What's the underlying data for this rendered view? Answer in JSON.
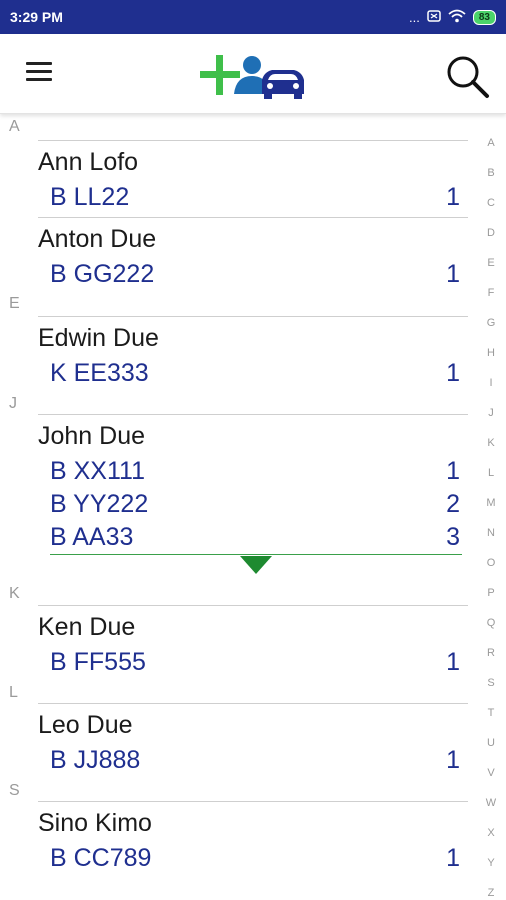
{
  "status_bar": {
    "time": "3:29 PM",
    "dots": "...",
    "battery": "83"
  },
  "colors": {
    "status_bar": "#1f2f8f",
    "plate_text": "#1f2f8f",
    "logo_green": "#3fbf4a",
    "logo_blue": "#1f6fb5",
    "logo_car": "#1f2f8f"
  },
  "icons": {
    "menu": "hamburger-menu-icon",
    "logo": "add-contact-car-logo",
    "search": "search-icon"
  },
  "sections": [
    {
      "letter": "A",
      "contacts": [
        {
          "name": "Ann Lofo",
          "plates": [
            {
              "plate": "B LL22",
              "count": "1"
            }
          ]
        },
        {
          "name": "Anton Due",
          "plates": [
            {
              "plate": "B GG222",
              "count": "1"
            }
          ]
        }
      ]
    },
    {
      "letter": "E",
      "contacts": [
        {
          "name": "Edwin Due",
          "plates": [
            {
              "plate": "K EE333",
              "count": "1"
            }
          ]
        }
      ]
    },
    {
      "letter": "J",
      "contacts": [
        {
          "name": "John Due",
          "plates": [
            {
              "plate": "B XX111",
              "count": "1"
            },
            {
              "plate": "B YY222",
              "count": "2"
            },
            {
              "plate": "B AA33",
              "count": "3"
            }
          ]
        }
      ]
    },
    {
      "letter": "K",
      "contacts": [
        {
          "name": "Ken Due",
          "plates": [
            {
              "plate": "B FF555",
              "count": "1"
            }
          ]
        }
      ]
    },
    {
      "letter": "L",
      "contacts": [
        {
          "name": "Leo Due",
          "plates": [
            {
              "plate": "B JJ888",
              "count": "1"
            }
          ]
        }
      ]
    },
    {
      "letter": "S",
      "contacts": [
        {
          "name": "Sino Kimo",
          "plates": [
            {
              "plate": "B CC789",
              "count": "1"
            }
          ]
        }
      ]
    }
  ],
  "alphabet": [
    "A",
    "B",
    "C",
    "D",
    "E",
    "F",
    "G",
    "H",
    "I",
    "J",
    "K",
    "L",
    "M",
    "N",
    "O",
    "P",
    "Q",
    "R",
    "S",
    "T",
    "U",
    "V",
    "W",
    "X",
    "Y",
    "Z"
  ]
}
